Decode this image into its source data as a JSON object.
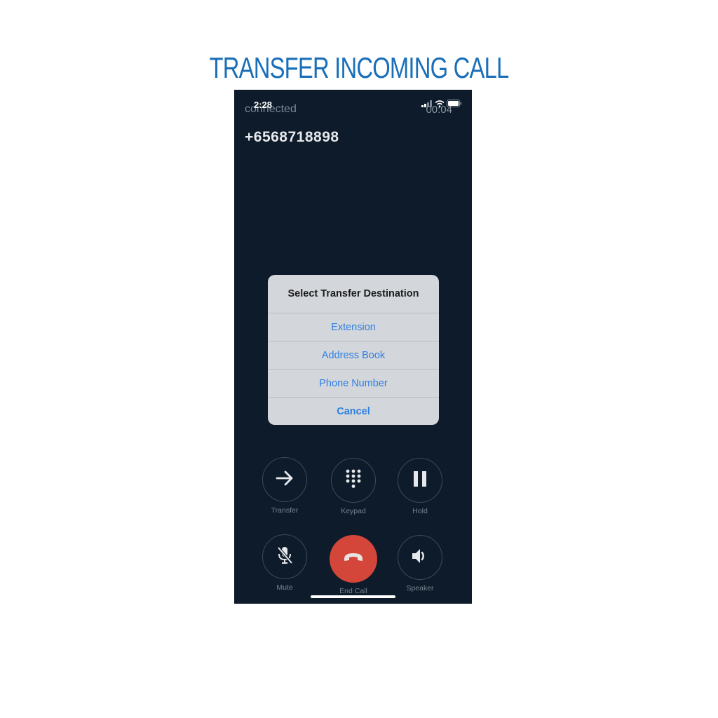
{
  "headline": "TRANSFER INCOMING CALL",
  "status_bar": {
    "time": "2:28",
    "signal_icon": "cellular-signal-icon",
    "wifi_icon": "wifi-icon",
    "battery_icon": "battery-icon"
  },
  "call": {
    "status": "connected",
    "timer": "00:04",
    "number": "+6568718898"
  },
  "action_sheet": {
    "title": "Select Transfer Destination",
    "options": [
      {
        "label": "Extension"
      },
      {
        "label": "Address Book"
      },
      {
        "label": "Phone Number"
      }
    ],
    "cancel_label": "Cancel"
  },
  "controls": [
    {
      "label": "Transfer",
      "icon": "arrow-right-icon"
    },
    {
      "label": "Keypad",
      "icon": "keypad-icon"
    },
    {
      "label": "Hold",
      "icon": "pause-icon"
    },
    {
      "label": "Mute",
      "icon": "microphone-muted-icon"
    },
    {
      "label": "End Call",
      "icon": "hang-up-icon"
    },
    {
      "label": "Speaker",
      "icon": "speaker-icon"
    }
  ],
  "colors": {
    "headline": "#1a6fb8",
    "background": "#0d1b2b",
    "sheet_accent": "#2f7fe3",
    "end_call": "#d5463a"
  }
}
